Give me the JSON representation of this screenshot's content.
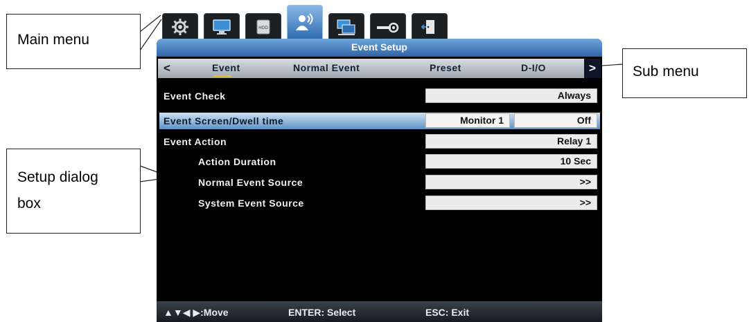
{
  "callouts": {
    "main_menu": "Main menu",
    "sub_menu": "Sub menu",
    "setup_dialog_line1": "Setup dialog",
    "setup_dialog_line2": "box"
  },
  "main_menu_icons": [
    {
      "icon": "gear-icon",
      "active": false
    },
    {
      "icon": "monitor-icon",
      "active": false
    },
    {
      "icon": "hdd-icon",
      "active": false,
      "label": "HDD"
    },
    {
      "icon": "event-person-icon",
      "active": true
    },
    {
      "icon": "network-icon",
      "active": false
    },
    {
      "icon": "device-settings-icon",
      "active": false
    },
    {
      "icon": "exit-door-icon",
      "active": false
    }
  ],
  "dialog": {
    "title": "Event Setup",
    "sub_menu": {
      "left_arrow": "<",
      "right_arrow": ">",
      "tabs": [
        "Event",
        "Normal Event",
        "Preset",
        "D-I/O"
      ],
      "selected": "Event"
    },
    "rows": [
      {
        "label": "Event Check",
        "values": [
          "Always"
        ]
      },
      {
        "label": "Event Screen/Dwell time",
        "values": [
          "Monitor 1",
          "Off"
        ],
        "selected": true
      },
      {
        "label": "Event Action",
        "values": [
          "Relay 1"
        ]
      },
      {
        "label": "Action Duration",
        "values": [
          "10 Sec"
        ]
      },
      {
        "label": "Normal Event Source",
        "values": [
          ">>"
        ]
      },
      {
        "label": "System Event Source",
        "values": [
          ">>"
        ]
      }
    ],
    "footer": {
      "move": "▲▼◀ ▶:Move",
      "select": "ENTER: Select",
      "exit": "ESC: Exit"
    }
  },
  "colors": {
    "title_bar": "#3d78bf",
    "selected_row": "#8fb7dd",
    "panel_bg": "#000000",
    "sub_underline": "#e6c220"
  }
}
